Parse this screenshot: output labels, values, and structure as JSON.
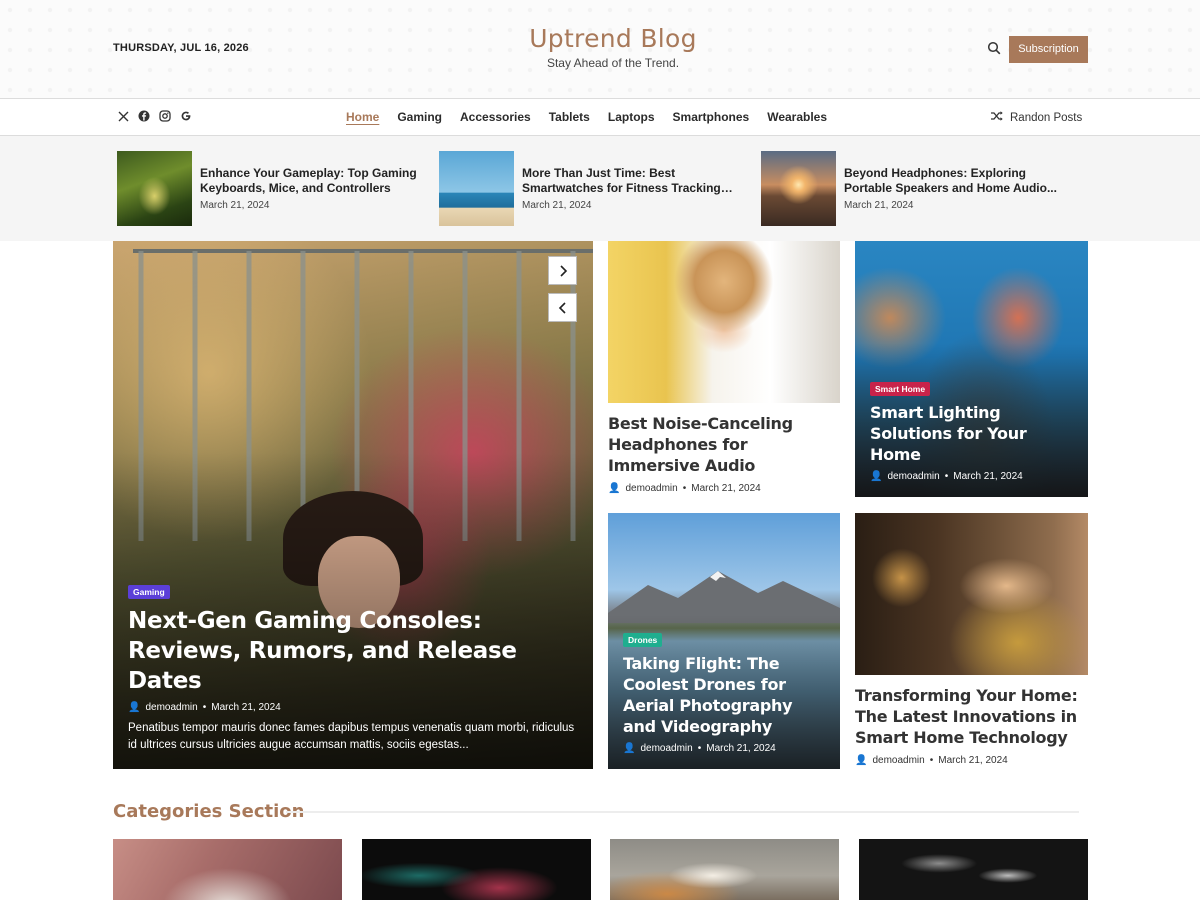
{
  "header": {
    "date": "THURSDAY, JUL 16, 2026",
    "site_title": "Uptrend Blog",
    "tagline": "Stay Ahead of the Trend.",
    "subscribe_label": "Subscription",
    "search_icon": "search-icon"
  },
  "nav": {
    "socials": [
      "x-icon",
      "facebook-icon",
      "instagram-icon",
      "google-icon"
    ],
    "items": [
      {
        "label": "Home",
        "active": true
      },
      {
        "label": "Gaming"
      },
      {
        "label": "Accessories"
      },
      {
        "label": "Tablets"
      },
      {
        "label": "Laptops"
      },
      {
        "label": "Smartphones"
      },
      {
        "label": "Wearables"
      }
    ],
    "random_label": "Randon Posts",
    "random_icon": "shuffle-icon"
  },
  "ticker": [
    {
      "title": "Enhance Your Gameplay: Top Gaming Keyboards, Mice, and Controllers",
      "date": "March 21, 2024"
    },
    {
      "title": "More Than Just Time: Best Smartwatches for Fitness Tracking an...",
      "date": "March 21, 2024"
    },
    {
      "title": "Beyond Headphones: Exploring Portable Speakers and Home Audio...",
      "date": "March 21, 2024"
    }
  ],
  "featured": {
    "category": "Gaming",
    "title": "Next-Gen Gaming Consoles: Reviews, Rumors, and Release Dates",
    "author": "demoadmin",
    "date": "March 21, 2024",
    "excerpt": "Penatibus tempor mauris donec fames dapibus tempus venenatis quam morbi, ridiculus id ultrices cursus ultricies augue accumsan mattis, sociis egestas..."
  },
  "posts": {
    "headphones": {
      "title": "Best Noise-Canceling Headphones for Immersive Audio",
      "author": "demoadmin",
      "date": "March 21, 2024"
    },
    "lighting": {
      "category": "Smart Home",
      "title": "Smart Lighting Solutions for Your Home",
      "author": "demoadmin",
      "date": "March 21, 2024"
    },
    "drones": {
      "category": "Drones",
      "title": "Taking Flight: The Coolest Drones for Aerial Photography and Videography",
      "author": "demoadmin",
      "date": "March 21, 2024"
    },
    "home": {
      "title": "Transforming Your Home: The Latest Innovations in Smart Home Technology",
      "author": "demoadmin",
      "date": "March 21, 2024"
    }
  },
  "categories": {
    "heading": "Categories Section"
  },
  "colors": {
    "accent": "#a8795a",
    "badge_gaming": "#5b3fd8",
    "badge_smart_home": "#c8234a",
    "badge_drones": "#1fae8f"
  }
}
